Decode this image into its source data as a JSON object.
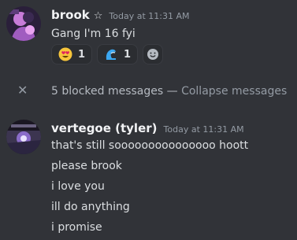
{
  "messages": [
    {
      "username": "brook",
      "star": "☆",
      "timestamp": "Today at 11:31 AM",
      "lines": [
        "Gang I'm 16 fyi"
      ],
      "reactions": [
        {
          "emoji": "heart-eyes",
          "count": "1"
        },
        {
          "emoji": "blue-wave",
          "count": "1"
        }
      ]
    },
    {
      "username": "vertegoe (tyler)",
      "timestamp": "Today at 11:31 AM",
      "lines": [
        "that's still sooooooooooooooo hoott",
        "please brook",
        "i love you",
        "ill do anything",
        "i promise"
      ]
    }
  ],
  "blocked": {
    "icon": "close-icon",
    "text": "5 blocked messages",
    "separator": "—",
    "collapse": "Collapse messages"
  },
  "colors": {
    "background": "#313338",
    "username": "#f2f3f5",
    "text": "#dbdee1",
    "muted": "#949ba4"
  }
}
